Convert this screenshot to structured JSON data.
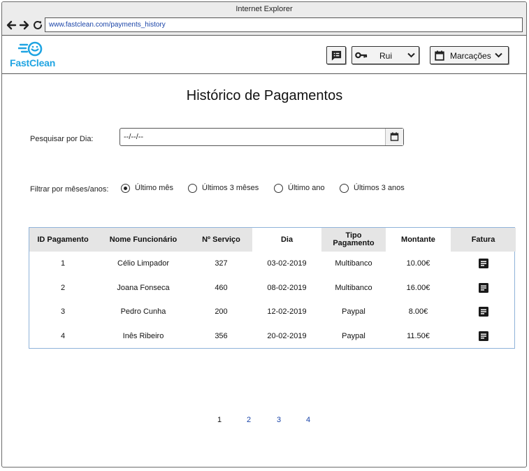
{
  "browser": {
    "title": "Internet Explorer",
    "url": "www.fastclean.com/payments_history"
  },
  "app": {
    "logo_text": "FastClean",
    "brand_color": "#1fa4e2",
    "header": {
      "chat_icon": "message-list-icon",
      "user_label": "Rui",
      "user_icon": "key-icon",
      "bookings_label": "Marcações",
      "bookings_icon": "calendar-icon"
    }
  },
  "page": {
    "title": "Histórico de Pagamentos",
    "search": {
      "label": "Pesquisar por Dia:",
      "value": "--/--/--"
    },
    "filter": {
      "label": "Filtrar por mêses/anos:",
      "options": [
        {
          "label": "Último mês",
          "selected": true
        },
        {
          "label": "Últimos 3 mêses",
          "selected": false
        },
        {
          "label": "Último ano",
          "selected": false
        },
        {
          "label": "Últimos 3 anos",
          "selected": false
        }
      ]
    },
    "table": {
      "headers": [
        "ID Pagamento",
        "Nome Funcionário",
        "Nº Serviço",
        "Dia",
        "Tipo\nPagamento",
        "Montante",
        "Fatura"
      ],
      "rows": [
        [
          "1",
          "Célio Limpador",
          "327",
          "03-02-2019",
          "Multibanco",
          "10.00€"
        ],
        [
          "2",
          "Joana Fonseca",
          "460",
          "08-02-2019",
          "Multibanco",
          "16.00€"
        ],
        [
          "3",
          "Pedro Cunha",
          "200",
          "12-02-2019",
          "Paypal",
          "8.00€"
        ],
        [
          "4",
          "Inês Ribeiro",
          "356",
          "20-02-2019",
          "Paypal",
          "11.50€"
        ]
      ],
      "invoice_icon": "document-icon"
    },
    "pagination": {
      "pages": [
        "1",
        "2",
        "3",
        "4"
      ],
      "current": "1"
    }
  }
}
